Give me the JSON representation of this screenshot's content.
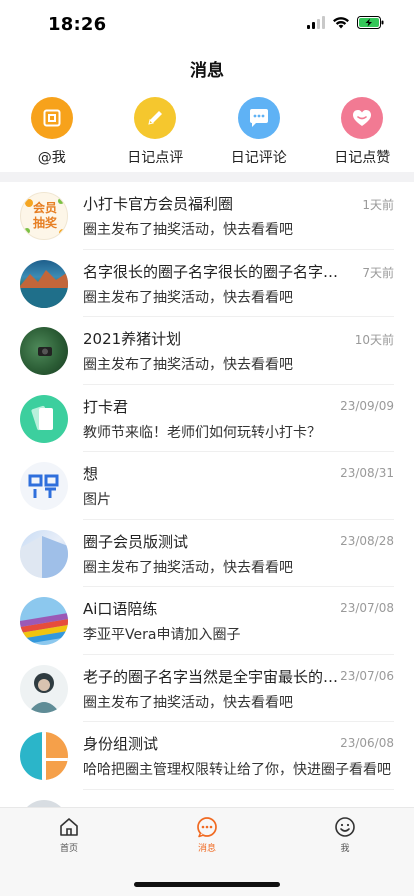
{
  "status": {
    "time": "18:26"
  },
  "header": {
    "title": "消息"
  },
  "quick_actions": [
    {
      "label": "@我",
      "icon": "at-me-icon",
      "color": "#f7a21b"
    },
    {
      "label": "日记点评",
      "icon": "pencil-icon",
      "color": "#f5c72e"
    },
    {
      "label": "日记评论",
      "icon": "chat-bubble-icon",
      "color": "#5fb2f5"
    },
    {
      "label": "日记点赞",
      "icon": "heart-icon",
      "color": "#f27a93"
    }
  ],
  "messages": [
    {
      "title": "小打卡官方会员福利圈",
      "time": "1天前",
      "subtitle": "圈主发布了抽奖活动，快去看看吧",
      "avatar_text": "会员抽奖"
    },
    {
      "title": "名字很长的圈子名字很长的圈子名字很长的圈子",
      "time": "7天前",
      "subtitle": "圈主发布了抽奖活动，快去看看吧"
    },
    {
      "title": "2021养猪计划",
      "time": "10天前",
      "subtitle": "圈主发布了抽奖活动，快去看看吧"
    },
    {
      "title": "打卡君",
      "time": "23/09/09",
      "subtitle": "教师节来临！老师们如何玩转小打卡？"
    },
    {
      "title": "想",
      "time": "23/08/31",
      "subtitle": "图片"
    },
    {
      "title": "圈子会员版测试",
      "time": "23/08/28",
      "subtitle": "圈主发布了抽奖活动，快去看看吧"
    },
    {
      "title": "Ai口语陪练",
      "time": "23/07/08",
      "subtitle": "李亚平Vera申请加入圈子"
    },
    {
      "title": "老子的圈子名字当然是全宇宙最长的圈子名字",
      "time": "23/07/06",
      "subtitle": "圈主发布了抽奖活动，快去看看吧"
    },
    {
      "title": "身份组测试",
      "time": "23/06/08",
      "subtitle": "哈哈把圈主管理权限转让给了你，快进圈子看看吧"
    }
  ],
  "tabs": [
    {
      "label": "首页",
      "icon": "home-icon"
    },
    {
      "label": "消息",
      "icon": "message-icon",
      "active": true
    },
    {
      "label": "我",
      "icon": "smiley-icon"
    }
  ],
  "colors": {
    "accent": "#f06a22"
  }
}
